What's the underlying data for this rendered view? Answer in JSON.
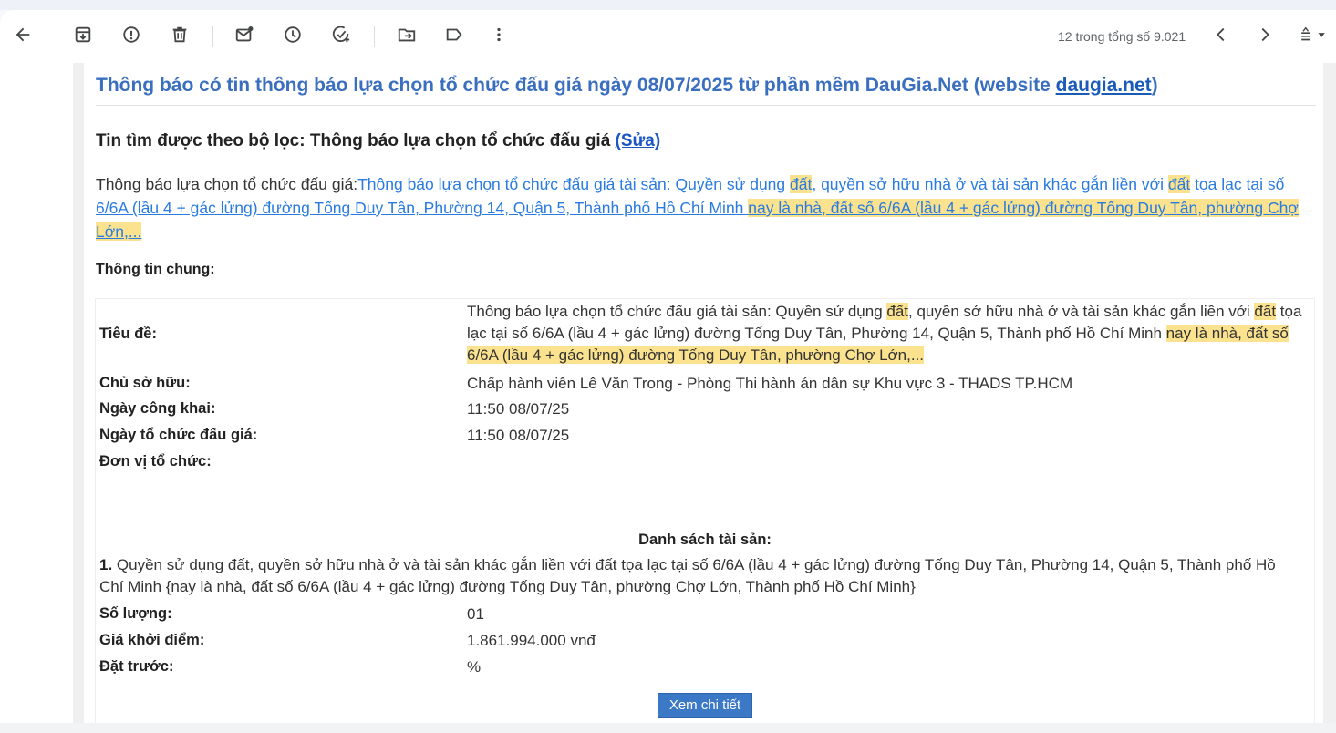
{
  "toolbar": {
    "counter": "12 trong tổng số 9.021"
  },
  "email": {
    "title_prefix": "Thông báo có tin thông báo lựa chọn tổ chức đấu giá ngày 08/07/2025 từ phần mềm DauGia.Net (website ",
    "title_link": "daugia.net",
    "title_suffix": ")",
    "filter_prefix": "Tin tìm được theo bộ lọc: Thông báo lựa chọn tổ chức đấu giá ",
    "filter_edit": "(Sửa)",
    "notice_label": "Thông báo lựa chọn tổ chức đấu giá:",
    "notice_link_1": "Thông báo lựa chọn tổ chức đấu giá tài sản: Quyền sử dụng ",
    "notice_hl_1": "đất",
    "notice_link_2": ", quyền sở hữu nhà ở và tài sản khác gắn liền với ",
    "notice_hl_2": "đất",
    "notice_link_3": " tọa lạc tại số 6/6A (lầu 4 + gác lửng) đường Tống Duy Tân, Phường 14, Quận 5, Thành phố Hồ Chí Minh ",
    "notice_hl_3": "nay là nhà, đất số 6/6A (lầu 4 + gác lửng) đường Tống Duy Tân, phường Chợ Lớn,...",
    "general_info_label": "Thông tin chung:",
    "info": {
      "title_label": "Tiêu đề:",
      "title_v1": "Thông báo lựa chọn tổ chức đấu giá tài sản: Quyền sử dụng ",
      "title_hl1": "đất",
      "title_v2": ", quyền sở hữu nhà ở và tài sản khác gắn liền với ",
      "title_hl2": "đất",
      "title_v3": " tọa lạc tại số 6/6A (lầu 4 + gác lửng) đường Tống Duy Tân, Phường 14, Quận 5, Thành phố Hồ Chí Minh ",
      "title_hl3": "nay là nhà, đất số 6/6A (lầu 4 + gác lửng) đường Tống Duy Tân, phường Chợ Lớn,...",
      "owner_label": "Chủ sở hữu:",
      "owner_value": "Chấp hành viên Lê Văn Trong - Phòng Thi hành án dân sự Khu vực 3 - THADS TP.HCM",
      "public_date_label": "Ngày công khai:",
      "public_date_value": "11:50 08/07/25",
      "auction_date_label": "Ngày tổ chức đấu giá:",
      "auction_date_value": "11:50 08/07/25",
      "organizer_label": "Đơn vị tổ chức:",
      "organizer_value": ""
    },
    "assets": {
      "heading": "Danh sách tài sản:",
      "item_number": "1.",
      "item_text": " Quyền sử dụng đất, quyền sở hữu nhà ở và tài sản khác gắn liền với đất tọa lạc tại số 6/6A (lầu 4 + gác lửng) đường Tống Duy Tân, Phường 14, Quận 5, Thành phố Hồ Chí Minh {nay là nhà, đất số 6/6A (lầu 4 + gác lửng) đường Tống Duy Tân, phường Chợ Lớn, Thành phố Hồ Chí Minh}",
      "quantity_label": "Số lượng:",
      "quantity_value": "01",
      "start_price_label": "Giá khởi điểm:",
      "start_price_value": "1.861.994.000 vnđ",
      "deposit_label": "Đặt trước:",
      "deposit_value": "%"
    },
    "detail_button": "Xem chi tiết"
  },
  "icons": [
    "back-arrow-icon",
    "archive-icon",
    "report-spam-icon",
    "delete-icon",
    "mark-unread-icon",
    "snooze-icon",
    "add-task-icon",
    "move-to-icon",
    "label-icon",
    "more-vert-icon",
    "chevron-left-icon",
    "chevron-right-icon",
    "input-tools-icon"
  ],
  "colors": {
    "title_blue": "#3a6fbf",
    "link_blue": "#2a7be0",
    "highlight": "#fbe28f",
    "button_blue": "#3b78c6"
  }
}
